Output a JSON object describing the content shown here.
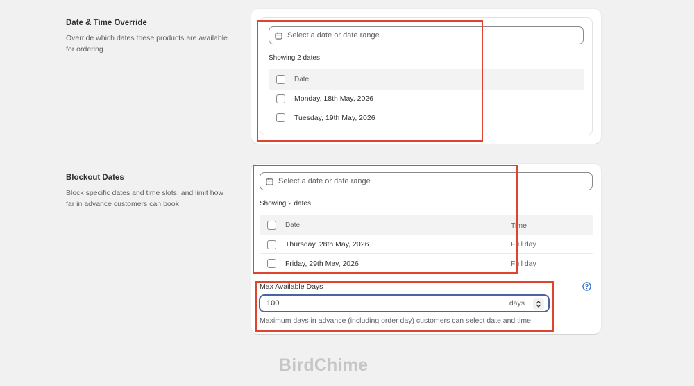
{
  "override": {
    "title": "Date & Time Override",
    "description": "Override which dates these products are available for ordering",
    "date_placeholder": "Select a date or date range",
    "showing": "Showing 2 dates",
    "header_date": "Date",
    "rows": [
      "Monday, 18th May, 2026",
      "Tuesday, 19th May, 2026"
    ]
  },
  "blockout": {
    "title": "Blockout Dates",
    "description": "Block specific dates and time slots, and limit how far in advance customers can book",
    "date_placeholder": "Select a date or date range",
    "showing": "Showing 2 dates",
    "header_date": "Date",
    "header_time": "Time",
    "rows": [
      {
        "date": "Thursday, 28th May, 2026",
        "time": "Full day"
      },
      {
        "date": "Friday, 29th May, 2026",
        "time": "Full day"
      }
    ]
  },
  "max_days": {
    "label": "Max Available Days",
    "value": "100",
    "suffix": "days",
    "help": "Maximum days in advance (including order day) customers can select date and time"
  },
  "logo": "BirdChime",
  "colors": {
    "highlight": "#e0442e",
    "focus": "#4a63a6",
    "help_icon": "#2c6ecb"
  },
  "icons": [
    "calendar-icon",
    "help-icon",
    "stepper-icon"
  ]
}
